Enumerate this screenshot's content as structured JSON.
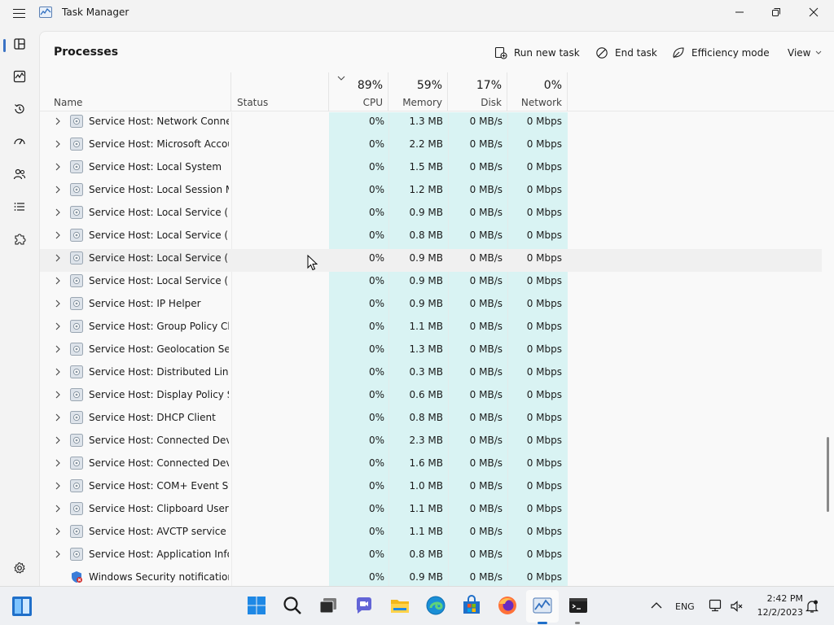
{
  "window": {
    "title": "Task Manager"
  },
  "header": {
    "page_title": "Processes",
    "run_new_task": "Run new task",
    "end_task": "End task",
    "efficiency_mode": "Efficiency mode",
    "view": "View"
  },
  "columns": {
    "name": "Name",
    "status": "Status",
    "cpu": {
      "percent": "89%",
      "label": "CPU"
    },
    "memory": {
      "percent": "59%",
      "label": "Memory"
    },
    "disk": {
      "percent": "17%",
      "label": "Disk"
    },
    "network": {
      "percent": "0%",
      "label": "Network"
    }
  },
  "processes": [
    {
      "name": "Service Host: Network Connec...",
      "cpu": "0%",
      "memory": "1.3 MB",
      "disk": "0 MB/s",
      "network": "0 Mbps"
    },
    {
      "name": "Service Host: Microsoft Accou...",
      "cpu": "0%",
      "memory": "2.2 MB",
      "disk": "0 MB/s",
      "network": "0 Mbps"
    },
    {
      "name": "Service Host: Local System",
      "cpu": "0%",
      "memory": "1.5 MB",
      "disk": "0 MB/s",
      "network": "0 Mbps"
    },
    {
      "name": "Service Host: Local Session M...",
      "cpu": "0%",
      "memory": "1.2 MB",
      "disk": "0 MB/s",
      "network": "0 Mbps"
    },
    {
      "name": "Service Host: Local Service (N...",
      "cpu": "0%",
      "memory": "0.9 MB",
      "disk": "0 MB/s",
      "network": "0 Mbps"
    },
    {
      "name": "Service Host: Local Service (N...",
      "cpu": "0%",
      "memory": "0.8 MB",
      "disk": "0 MB/s",
      "network": "0 Mbps"
    },
    {
      "name": "Service Host: Local Service (N...",
      "cpu": "0%",
      "memory": "0.9 MB",
      "disk": "0 MB/s",
      "network": "0 Mbps"
    },
    {
      "name": "Service Host: Local Service (N...",
      "cpu": "0%",
      "memory": "0.9 MB",
      "disk": "0 MB/s",
      "network": "0 Mbps"
    },
    {
      "name": "Service Host: IP Helper",
      "cpu": "0%",
      "memory": "0.9 MB",
      "disk": "0 MB/s",
      "network": "0 Mbps"
    },
    {
      "name": "Service Host: Group Policy Cli...",
      "cpu": "0%",
      "memory": "1.1 MB",
      "disk": "0 MB/s",
      "network": "0 Mbps"
    },
    {
      "name": "Service Host: Geolocation Serv...",
      "cpu": "0%",
      "memory": "1.3 MB",
      "disk": "0 MB/s",
      "network": "0 Mbps"
    },
    {
      "name": "Service Host: Distributed Link ...",
      "cpu": "0%",
      "memory": "0.3 MB",
      "disk": "0 MB/s",
      "network": "0 Mbps"
    },
    {
      "name": "Service Host: Display Policy Se...",
      "cpu": "0%",
      "memory": "0.6 MB",
      "disk": "0 MB/s",
      "network": "0 Mbps"
    },
    {
      "name": "Service Host: DHCP Client",
      "cpu": "0%",
      "memory": "0.8 MB",
      "disk": "0 MB/s",
      "network": "0 Mbps"
    },
    {
      "name": "Service Host: Connected Devi...",
      "cpu": "0%",
      "memory": "2.3 MB",
      "disk": "0 MB/s",
      "network": "0 Mbps"
    },
    {
      "name": "Service Host: Connected Devi...",
      "cpu": "0%",
      "memory": "1.6 MB",
      "disk": "0 MB/s",
      "network": "0 Mbps"
    },
    {
      "name": "Service Host: COM+ Event Sys...",
      "cpu": "0%",
      "memory": "1.0 MB",
      "disk": "0 MB/s",
      "network": "0 Mbps"
    },
    {
      "name": "Service Host: Clipboard User S...",
      "cpu": "0%",
      "memory": "1.1 MB",
      "disk": "0 MB/s",
      "network": "0 Mbps"
    },
    {
      "name": "Service Host: AVCTP service",
      "cpu": "0%",
      "memory": "1.1 MB",
      "disk": "0 MB/s",
      "network": "0 Mbps"
    },
    {
      "name": "Service Host: Application Infor...",
      "cpu": "0%",
      "memory": "0.8 MB",
      "disk": "0 MB/s",
      "network": "0 Mbps"
    },
    {
      "name": "Windows Security notification...",
      "cpu": "0%",
      "memory": "0.9 MB",
      "disk": "0 MB/s",
      "network": "0 Mbps"
    }
  ],
  "taskbar": {
    "language": "ENG",
    "time": "2:42 PM",
    "date": "12/2/2023"
  },
  "colors": {
    "heat": "#d9f3f3",
    "accent": "#3a72c4"
  }
}
